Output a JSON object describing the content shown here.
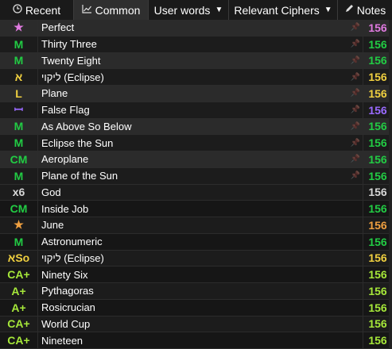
{
  "toolbar": {
    "recent_label": "Recent",
    "common_label": "Common",
    "userwords_label": "User words",
    "ciphers_label": "Relevant Ciphers",
    "notes_label": "Notes",
    "recent_icon": "clock-icon",
    "common_icon": "chart-icon",
    "notes_icon": "pencil-icon"
  },
  "rows": [
    {
      "badge": "★",
      "badge_color": "#e07ae0",
      "word": "Perfect",
      "value": "156",
      "value_color": "#e07ae0",
      "pinned": true
    },
    {
      "badge": "M",
      "badge_color": "#22cc44",
      "word": "Thirty Three",
      "value": "156",
      "value_color": "#22cc44",
      "pinned": true
    },
    {
      "badge": "M",
      "badge_color": "#22cc44",
      "word": "Twenty Eight",
      "value": "156",
      "value_color": "#22cc44",
      "pinned": true
    },
    {
      "badge": "א",
      "badge_color": "#f0d040",
      "word": "ליקוי (Eclipse)",
      "value": "156",
      "value_color": "#f0d040",
      "pinned": true
    },
    {
      "badge": "L",
      "badge_color": "#f0d040",
      "word": "Plane",
      "value": "156",
      "value_color": "#f0d040",
      "pinned": true
    },
    {
      "badge": "ꟷ",
      "badge_color": "#9a6aff",
      "word": "False Flag",
      "value": "156",
      "value_color": "#9a6aff",
      "pinned": true
    },
    {
      "badge": "M",
      "badge_color": "#22cc44",
      "word": "As Above So Below",
      "value": "156",
      "value_color": "#22cc44",
      "pinned": true
    },
    {
      "badge": "M",
      "badge_color": "#22cc44",
      "word": "Eclipse the Sun",
      "value": "156",
      "value_color": "#22cc44",
      "pinned": true
    },
    {
      "badge": "CM",
      "badge_color": "#22cc44",
      "word": "Aeroplane",
      "value": "156",
      "value_color": "#22cc44",
      "pinned": true
    },
    {
      "badge": "M",
      "badge_color": "#22cc44",
      "word": "Plane of the Sun",
      "value": "156",
      "value_color": "#22cc44",
      "pinned": true
    },
    {
      "badge": "x6",
      "badge_color": "#d8d8d8",
      "word": "God",
      "value": "156",
      "value_color": "#d8d8d8",
      "pinned": false
    },
    {
      "badge": "CM",
      "badge_color": "#22cc44",
      "word": "Inside Job",
      "value": "156",
      "value_color": "#22cc44",
      "pinned": false
    },
    {
      "badge": "★",
      "badge_color": "#f0a040",
      "word": "June",
      "value": "156",
      "value_color": "#f0a040",
      "pinned": false
    },
    {
      "badge": "M",
      "badge_color": "#22cc44",
      "word": "Astronumeric",
      "value": "156",
      "value_color": "#22cc44",
      "pinned": false
    },
    {
      "badge": "אSo",
      "badge_color": "#f0d040",
      "word": "ליקוי (Eclipse)",
      "value": "156",
      "value_color": "#f0d040",
      "pinned": false
    },
    {
      "badge": "CA+",
      "badge_color": "#a6e83a",
      "word": "Ninety Six",
      "value": "156",
      "value_color": "#a6e83a",
      "pinned": false
    },
    {
      "badge": "A+",
      "badge_color": "#a6e83a",
      "word": "Pythagoras",
      "value": "156",
      "value_color": "#a6e83a",
      "pinned": false
    },
    {
      "badge": "A+",
      "badge_color": "#a6e83a",
      "word": "Rosicrucian",
      "value": "156",
      "value_color": "#a6e83a",
      "pinned": false
    },
    {
      "badge": "CA+",
      "badge_color": "#a6e83a",
      "word": "World Cup",
      "value": "156",
      "value_color": "#a6e83a",
      "pinned": false
    },
    {
      "badge": "CA+",
      "badge_color": "#a6e83a",
      "word": "Nineteen",
      "value": "156",
      "value_color": "#a6e83a",
      "pinned": false
    }
  ]
}
